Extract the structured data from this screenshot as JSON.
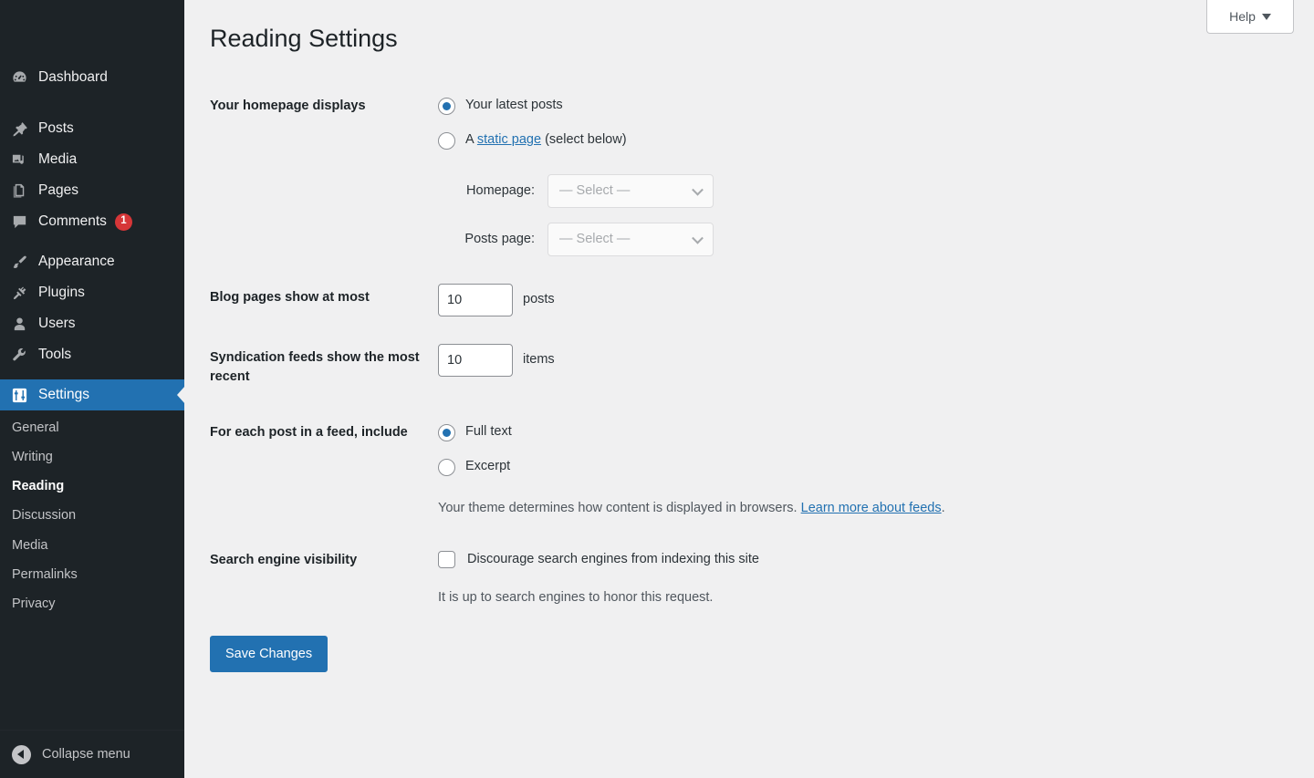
{
  "colors": {
    "sidebar_bg": "#1d2327",
    "accent": "#2271b1",
    "badge": "#d63638",
    "page_bg": "#f0f0f1",
    "link": "#2271b1"
  },
  "help_tab": {
    "label": "Help",
    "icon": "chevron-down-icon"
  },
  "page": {
    "title": "Reading Settings"
  },
  "sidebar": {
    "items": [
      {
        "label": "Dashboard",
        "icon": "dashboard-icon",
        "current": false
      },
      {
        "label": "Posts",
        "icon": "pin-icon",
        "current": false
      },
      {
        "label": "Media",
        "icon": "media-icon",
        "current": false
      },
      {
        "label": "Pages",
        "icon": "pages-icon",
        "current": false
      },
      {
        "label": "Comments",
        "icon": "comment-icon",
        "current": false,
        "badge": "1"
      },
      {
        "label": "Appearance",
        "icon": "brush-icon",
        "current": false
      },
      {
        "label": "Plugins",
        "icon": "plug-icon",
        "current": false
      },
      {
        "label": "Users",
        "icon": "user-icon",
        "current": false
      },
      {
        "label": "Tools",
        "icon": "wrench-icon",
        "current": false
      },
      {
        "label": "Settings",
        "icon": "settings-sliders-icon",
        "current": true
      }
    ],
    "submenu": [
      {
        "label": "General",
        "current": false
      },
      {
        "label": "Writing",
        "current": false
      },
      {
        "label": "Reading",
        "current": true
      },
      {
        "label": "Discussion",
        "current": false
      },
      {
        "label": "Media",
        "current": false
      },
      {
        "label": "Permalinks",
        "current": false
      },
      {
        "label": "Privacy",
        "current": false
      }
    ],
    "collapse": {
      "label": "Collapse menu",
      "icon": "arrow-left-circle-icon"
    }
  },
  "form": {
    "homepage_displays": {
      "label": "Your homepage displays",
      "options": [
        {
          "label": "Your latest posts",
          "checked": true
        },
        {
          "label_prefix": "A ",
          "link_text": "static page",
          "label_suffix": " (select below)",
          "checked": false
        }
      ],
      "homepage_select": {
        "label": "Homepage:",
        "value": "— Select —",
        "disabled": true
      },
      "posts_page_select": {
        "label": "Posts page:",
        "value": "— Select —",
        "disabled": true
      }
    },
    "blog_pages": {
      "label": "Blog pages show at most",
      "value": "10",
      "unit": "posts"
    },
    "syndication_feeds": {
      "label": "Syndication feeds show the most recent",
      "value": "10",
      "unit": "items"
    },
    "feed_include": {
      "label": "For each post in a feed, include",
      "options": [
        {
          "label": "Full text",
          "checked": true
        },
        {
          "label": "Excerpt",
          "checked": false
        }
      ],
      "description_prefix": "Your theme determines how content is displayed in browsers. ",
      "description_link": "Learn more about feeds",
      "description_suffix": "."
    },
    "search_visibility": {
      "label": "Search engine visibility",
      "checkbox_label": "Discourage search engines from indexing this site",
      "checked": false,
      "description": "It is up to search engines to honor this request."
    },
    "submit": {
      "label": "Save Changes"
    }
  }
}
